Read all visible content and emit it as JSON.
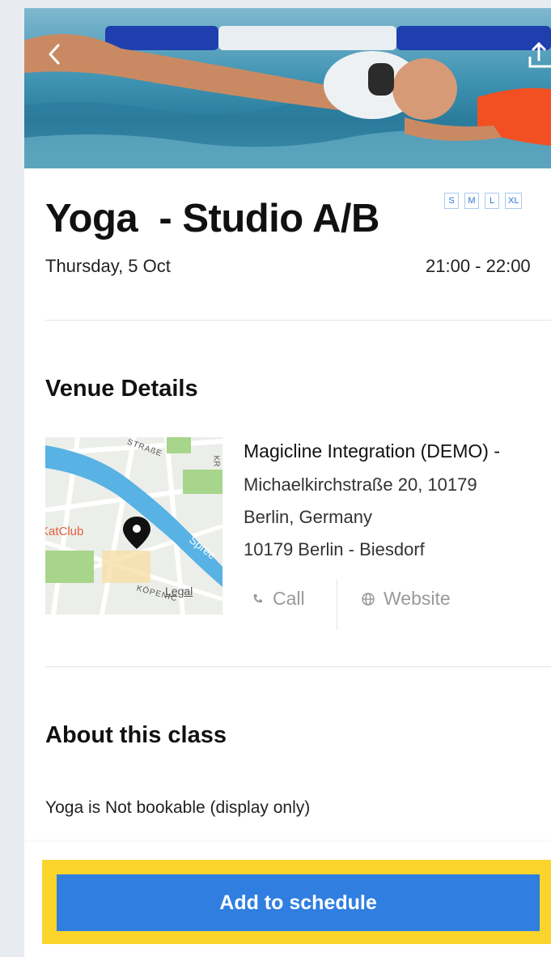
{
  "header": {
    "back_icon": "chevron-left-icon",
    "share_icon": "share-icon"
  },
  "class": {
    "title": "Yoga  - Studio A/B",
    "sizes": [
      "S",
      "M",
      "L",
      "XL"
    ],
    "date": "Thursday, 5 Oct",
    "time": "21:00 - 22:00"
  },
  "venue": {
    "section_title": "Venue Details",
    "name": "Magicline Integration (DEMO) -",
    "address_line1": "Michaelkirchstraße 20, 10179",
    "address_line2": "Berlin, Germany",
    "address_line3": "10179 Berlin - Biesdorf",
    "call_label": "Call",
    "website_label": "Website",
    "map": {
      "street_top": "STRAßE",
      "river": "Spree",
      "poi": "KatClub",
      "street_bottom": "KÖPENIC",
      "legal": "Legal",
      "street_side": "KR"
    }
  },
  "about": {
    "section_title": "About this class",
    "text": "Yoga is Not bookable (display only)"
  },
  "footer": {
    "cta_label": "Add to schedule"
  },
  "colors": {
    "accent": "#2f7ee0",
    "highlight": "#fbd42c",
    "chip": "#2c76d6"
  }
}
